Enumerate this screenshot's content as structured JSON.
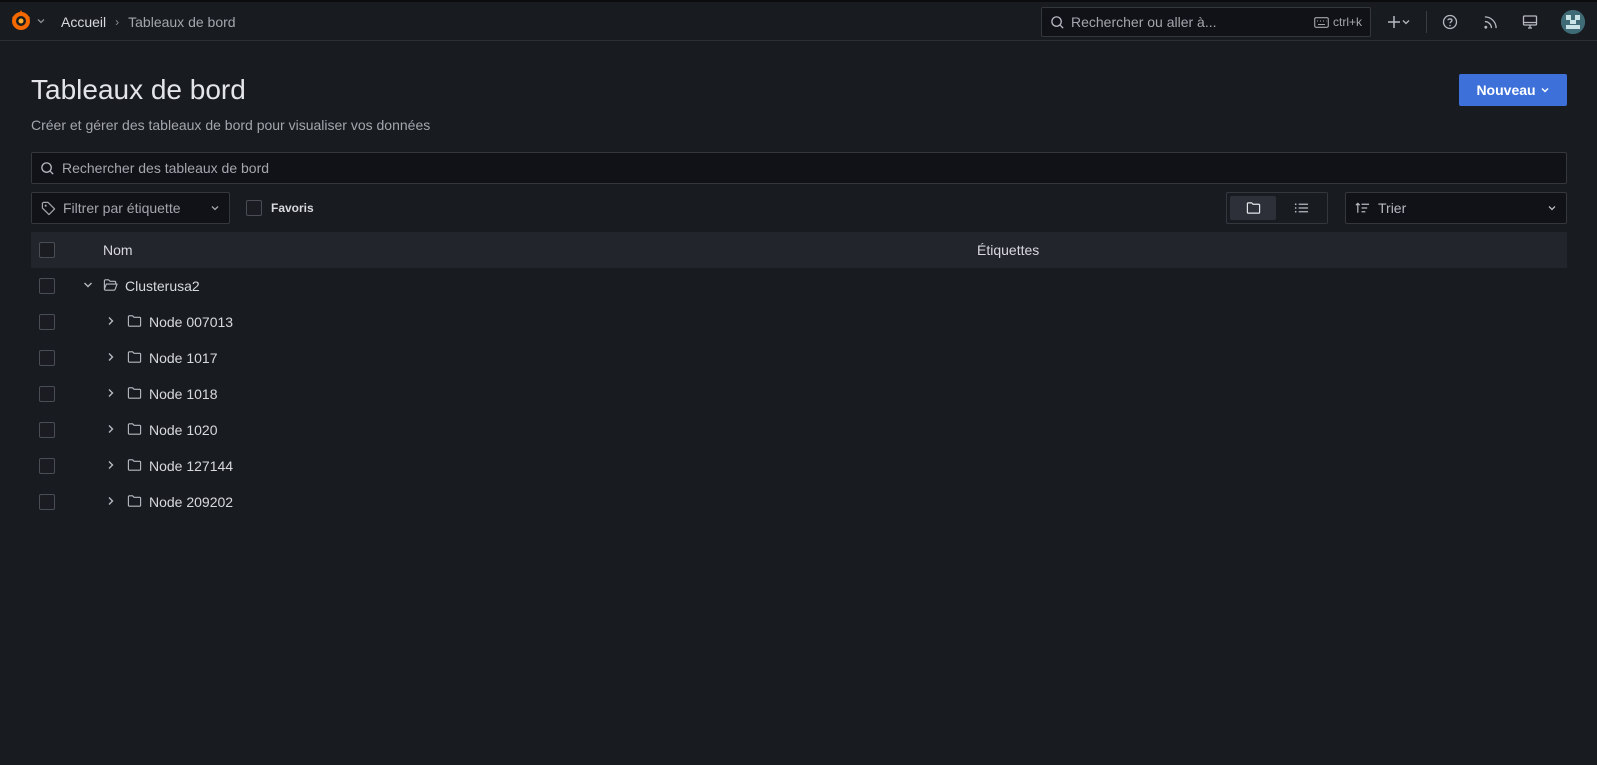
{
  "topbar": {
    "breadcrumb_home": "Accueil",
    "breadcrumb_current": "Tableaux de bord",
    "search_placeholder": "Rechercher ou aller à...",
    "search_shortcut": "ctrl+k"
  },
  "page": {
    "title": "Tableaux de bord",
    "subtitle": "Créer et gérer des tableaux de bord pour visualiser vos données",
    "new_button": "Nouveau",
    "search_placeholder": "Rechercher des tableaux de bord",
    "tag_filter": "Filtrer par étiquette",
    "favorites": "Favoris",
    "sort": "Trier"
  },
  "table": {
    "col_name": "Nom",
    "col_tags": "Étiquettes"
  },
  "tree": {
    "root": "Clusterusa2",
    "children": [
      "Node 007013",
      "Node 1017",
      "Node 1018",
      "Node 1020",
      "Node 127144",
      "Node 209202"
    ]
  },
  "colors": {
    "background": "#181b1f",
    "primary": "#3d71d9",
    "logo": "#f46800"
  }
}
